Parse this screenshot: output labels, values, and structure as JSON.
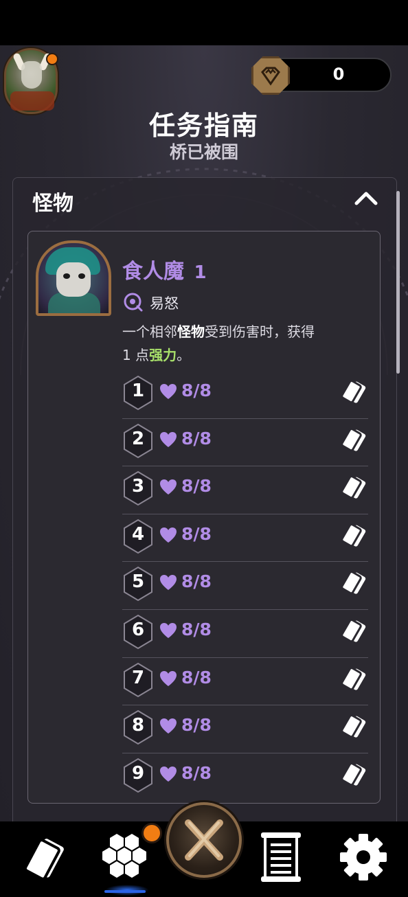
{
  "header": {
    "title": "任务指南",
    "subtitle": "桥已被围",
    "currency_value": "0"
  },
  "section": {
    "title": "怪物",
    "expanded": true
  },
  "monster": {
    "name": "食人魔",
    "count": "1",
    "trait": "易怒",
    "description_parts": {
      "p1": "一个相邻",
      "kw": "怪物",
      "p2": "受到伤害时，获得",
      "p3": "1 点",
      "buff": "强力",
      "p4": "。"
    },
    "instances": [
      {
        "number": "1",
        "hp": "8/8"
      },
      {
        "number": "2",
        "hp": "8/8"
      },
      {
        "number": "3",
        "hp": "8/8"
      },
      {
        "number": "4",
        "hp": "8/8"
      },
      {
        "number": "5",
        "hp": "8/8"
      },
      {
        "number": "6",
        "hp": "8/8"
      },
      {
        "number": "7",
        "hp": "8/8"
      },
      {
        "number": "8",
        "hp": "8/8"
      },
      {
        "number": "9",
        "hp": "8/8"
      }
    ]
  },
  "colors": {
    "accent_purple": "#b18ce6",
    "buff_green": "#a8e06a",
    "notification": "#f27d13",
    "active_tab": "#2a63e6"
  },
  "nav": {
    "items": [
      {
        "icon": "cards-icon",
        "active": false
      },
      {
        "icon": "hex-grid-icon",
        "active": true,
        "has_notification": true
      },
      {
        "icon": "crossed-swords-icon",
        "active": false
      },
      {
        "icon": "scroll-icon",
        "active": false
      },
      {
        "icon": "gear-icon",
        "active": false
      }
    ]
  }
}
